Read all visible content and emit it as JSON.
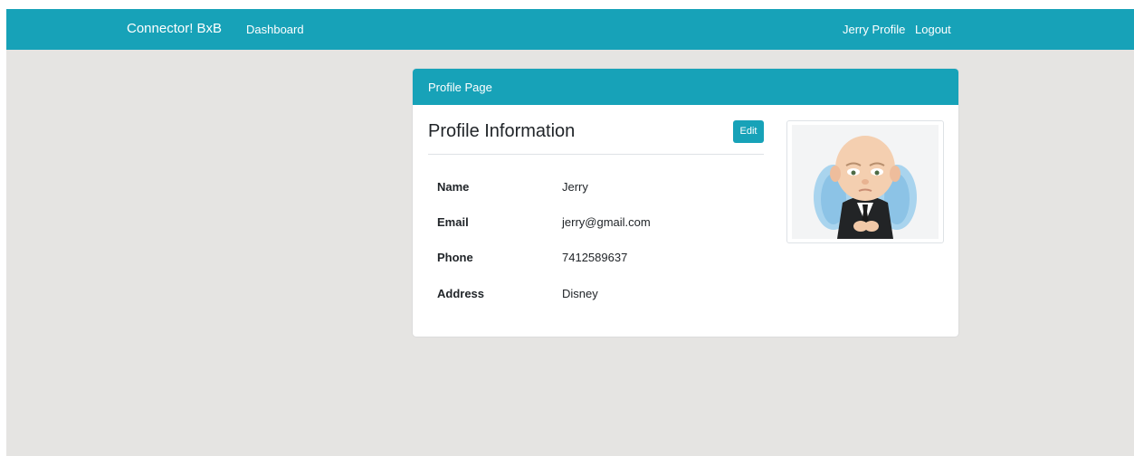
{
  "navbar": {
    "brand": "Connector! BxB",
    "links": {
      "dashboard": "Dashboard",
      "profile": "Jerry Profile",
      "logout": "Logout"
    }
  },
  "card": {
    "header_title": "Profile Page",
    "section_title": "Profile Information",
    "edit_label": "Edit",
    "fields": [
      {
        "label": "Name",
        "value": "Jerry"
      },
      {
        "label": "Email",
        "value": "jerry@gmail.com"
      },
      {
        "label": "Phone",
        "value": "7412589637"
      },
      {
        "label": "Address",
        "value": "Disney"
      }
    ]
  },
  "colors": {
    "accent": "#17a2b8",
    "page_background": "#e5e4e2",
    "card_background": "#ffffff",
    "text": "#212529"
  },
  "icons": {
    "avatar": "boss-baby-avatar"
  }
}
